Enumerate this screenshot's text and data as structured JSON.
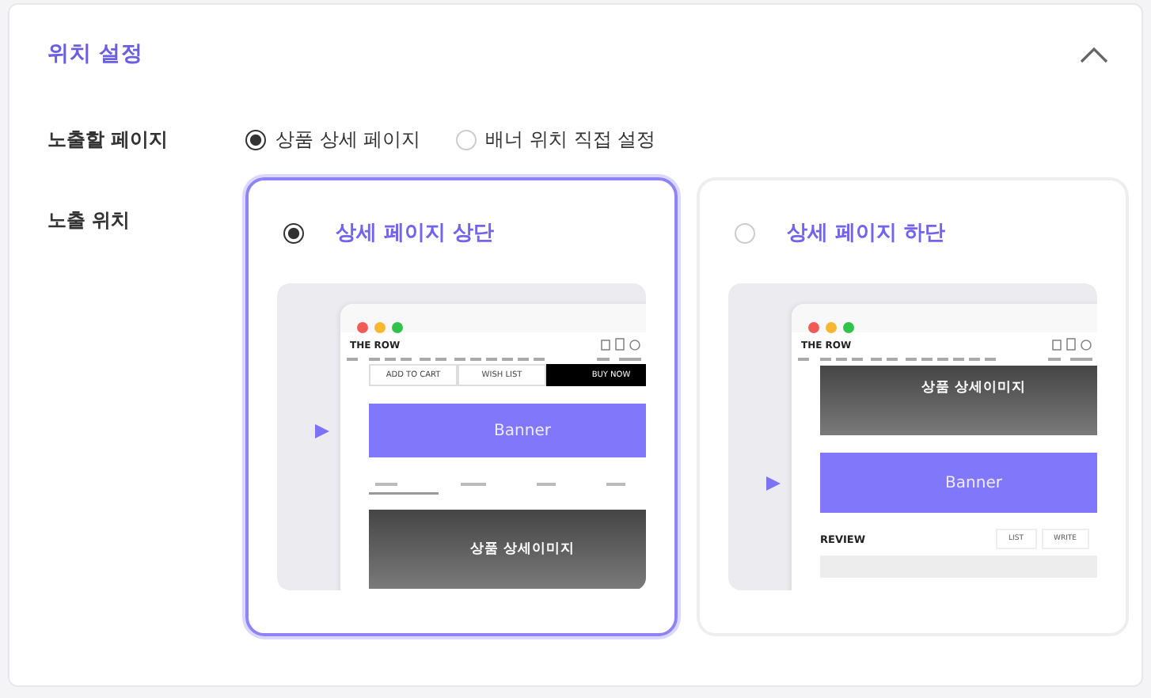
{
  "section": {
    "title": "위치 설정",
    "expanded": true
  },
  "rows": [
    {
      "label": "노출할 페이지",
      "kind": "radios",
      "options": [
        {
          "label": "상품 상세 페이지",
          "selected": true
        },
        {
          "label": "배너 위치 직접 설정",
          "selected": false
        }
      ]
    },
    {
      "label": "노출 위치",
      "kind": "cards",
      "options": [
        {
          "label": "상세 페이지 상단",
          "selected": true,
          "preview": {
            "brand": "THE ROW",
            "blocks": [
              {
                "kind": "buttons",
                "items": [
                  "ADD TO CART",
                  "WISH LIST",
                  "BUY NOW"
                ]
              },
              {
                "kind": "banner",
                "text": "Banner"
              },
              {
                "kind": "tabs"
              },
              {
                "kind": "image",
                "text": "상품 상세이미지"
              }
            ]
          }
        },
        {
          "label": "상세 페이지 하단",
          "selected": false,
          "preview": {
            "brand": "THE ROW",
            "blocks": [
              {
                "kind": "image",
                "text": "상품 상세이미지"
              },
              {
                "kind": "banner",
                "text": "Banner"
              },
              {
                "kind": "review",
                "title": "REVIEW",
                "items": [
                  "LIST",
                  "WRITE"
                ]
              }
            ]
          }
        }
      ]
    }
  ]
}
